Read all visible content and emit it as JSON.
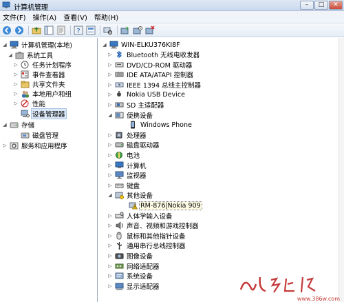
{
  "window": {
    "title": "计算机管理"
  },
  "window_buttons": {
    "minimize": "–",
    "maximize": "□",
    "close": "✕"
  },
  "menu": [
    {
      "label": "文件(F)"
    },
    {
      "label": "操作(A)"
    },
    {
      "label": "查看(V)"
    },
    {
      "label": "帮助(H)"
    }
  ],
  "left_tree": {
    "root": "计算机管理(本地)",
    "system_tools": "系统工具",
    "task_scheduler": "任务计划程序",
    "event_viewer": "事件查看器",
    "shared_folders": "共享文件夹",
    "local_users": "本地用户和组",
    "performance": "性能",
    "device_manager": "设备管理器",
    "storage": "存储",
    "disk_management": "磁盘管理",
    "services": "服务和应用程序"
  },
  "device_tree": {
    "computer": "WIN-ELKU376KI8F",
    "items": [
      "Bluetooth 无线电收发器",
      "DVD/CD-ROM 驱动器",
      "IDE ATA/ATAPI 控制器",
      "IEEE 1394 总线主控制器",
      "Nokia USB Device",
      "SD 主适配器",
      "便携设备",
      "Windows Phone",
      "处理器",
      "磁盘驱动器",
      "电池",
      "计算机",
      "监视器",
      "键盘",
      "其他设备",
      "RM-876|Nokia 909",
      "人体学输入设备",
      "声音、视频和游戏控制器",
      "鼠标和其他指针设备",
      "通用串行总线控制器",
      "图像设备",
      "网络适配器",
      "系统设备",
      "显示适配器"
    ]
  },
  "watermark": {
    "text": "www.386w.com"
  }
}
